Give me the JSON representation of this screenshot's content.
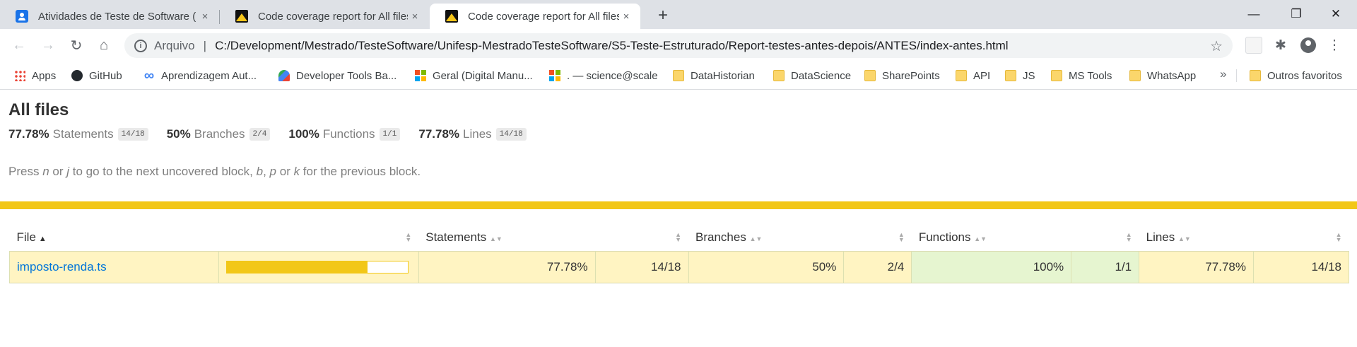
{
  "browser": {
    "tabs": [
      {
        "title": "Atividades de Teste de Software (",
        "close": "×"
      },
      {
        "title": "Code coverage report for All files",
        "close": "×"
      },
      {
        "title": "Code coverage report for All files",
        "close": "×"
      }
    ],
    "new_tab": "+",
    "window": {
      "minimize": "—",
      "restore": "❐",
      "close": "✕"
    },
    "omnibox": {
      "scheme_label": "Arquivo",
      "separator": "|",
      "url": "C:/Development/Mestrado/TesteSoftware/Unifesp-MestradoTesteSoftware/S5-Teste-Estruturado/Report-testes-antes-depois/ANTES/index-antes.html"
    },
    "bookmarks": [
      {
        "label": "Apps",
        "icon": "apps-grid"
      },
      {
        "label": "GitHub",
        "icon": "github"
      },
      {
        "label": "Aprendizagem Aut...",
        "icon": "infinity"
      },
      {
        "label": "Developer Tools Ba...",
        "icon": "devtools"
      },
      {
        "label": "Geral (Digital Manu...",
        "icon": "microsoft"
      },
      {
        "label": ". — science@scale",
        "icon": "microsoft"
      },
      {
        "label": "DataHistorian",
        "icon": "folder"
      },
      {
        "label": "DataScience",
        "icon": "folder"
      },
      {
        "label": "SharePoints",
        "icon": "folder"
      },
      {
        "label": "API",
        "icon": "folder"
      },
      {
        "label": "JS",
        "icon": "folder"
      },
      {
        "label": "MS Tools",
        "icon": "folder"
      },
      {
        "label": "WhatsApp",
        "icon": "folder"
      }
    ],
    "bookmarks_more": "»",
    "other_bookmarks": "Outros favoritos"
  },
  "report": {
    "title": "All files",
    "summary": [
      {
        "pct": "77.78%",
        "label": "Statements",
        "fraction": "14/18"
      },
      {
        "pct": "50%",
        "label": "Branches",
        "fraction": "2/4"
      },
      {
        "pct": "100%",
        "label": "Functions",
        "fraction": "1/1"
      },
      {
        "pct": "77.78%",
        "label": "Lines",
        "fraction": "14/18"
      }
    ],
    "hint": {
      "p1": "Press ",
      "k1": "n",
      "p2": " or ",
      "k2": "j",
      "p3": " to go to the next uncovered block, ",
      "k3": "b",
      "p4": ", ",
      "k4": "p",
      "p5": " or ",
      "k5": "k",
      "p6": " for the previous block."
    },
    "status_color": "#f2c718",
    "columns": {
      "file": "File",
      "file_sort": "▲",
      "statements": "Statements",
      "branches": "Branches",
      "functions": "Functions",
      "lines": "Lines"
    },
    "rows": [
      {
        "file": "imposto-renda.ts",
        "coverage_fraction": 0.7778,
        "statements_pct": "77.78%",
        "statements_frac": "14/18",
        "branches_pct": "50%",
        "branches_frac": "2/4",
        "functions_pct": "100%",
        "functions_frac": "1/1",
        "lines_pct": "77.78%",
        "lines_frac": "14/18"
      }
    ]
  }
}
